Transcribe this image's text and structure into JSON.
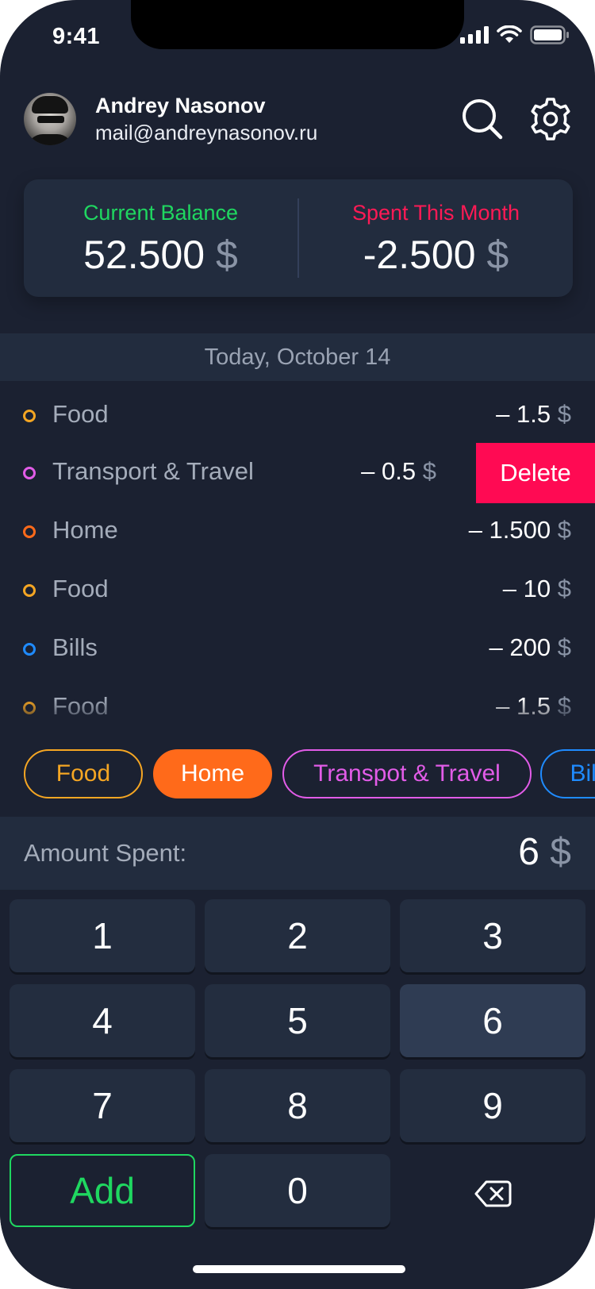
{
  "status_bar": {
    "time": "9:41"
  },
  "profile": {
    "name": "Andrey Nasonov",
    "email": "mail@andreynasonov.ru"
  },
  "header_icons": [
    "search-icon",
    "gear-icon"
  ],
  "balance": {
    "current_label": "Current Balance",
    "current_value": "52.500",
    "spent_label": "Spent This Month",
    "spent_value": "-2.500",
    "currency": "$"
  },
  "date_header": "Today, October 14",
  "transactions": [
    {
      "category": "Food",
      "amount": "– 1.5",
      "currency": "$",
      "color": "#f5a623"
    },
    {
      "category": "Transport & Travel",
      "amount": "– 0.5",
      "currency": "$",
      "color": "#e25ce8",
      "swiped": true,
      "action": "Delete"
    },
    {
      "category": "Home",
      "amount": "– 1.500",
      "currency": "$",
      "color": "#ff6a1a"
    },
    {
      "category": "Food",
      "amount": "– 10",
      "currency": "$",
      "color": "#f5a623"
    },
    {
      "category": "Bills",
      "amount": "– 200",
      "currency": "$",
      "color": "#1f8bff"
    },
    {
      "category": "Food",
      "amount": "– 1.5",
      "currency": "$",
      "color": "#f5a623"
    }
  ],
  "category_chips": [
    {
      "label": "Food",
      "color": "#f5a623",
      "selected": false
    },
    {
      "label": "Home",
      "color": "#ff6a1a",
      "selected": true
    },
    {
      "label": "Transpot & Travel",
      "color": "#e25ce8",
      "selected": false
    },
    {
      "label": "Bills",
      "color": "#1f8bff",
      "selected": false
    }
  ],
  "amount_entry": {
    "label": "Amount Spent:",
    "value": "6",
    "currency": "$"
  },
  "keypad": {
    "keys": [
      "1",
      "2",
      "3",
      "4",
      "5",
      "6",
      "7",
      "8",
      "9",
      "Add",
      "0",
      "backspace-icon"
    ],
    "active_key": "6",
    "add_color": "#1fd760"
  },
  "colors": {
    "background": "#1b2131",
    "card": "#222c3e",
    "positive": "#1fd760",
    "negative": "#ff1a55",
    "delete": "#ff0a53"
  }
}
